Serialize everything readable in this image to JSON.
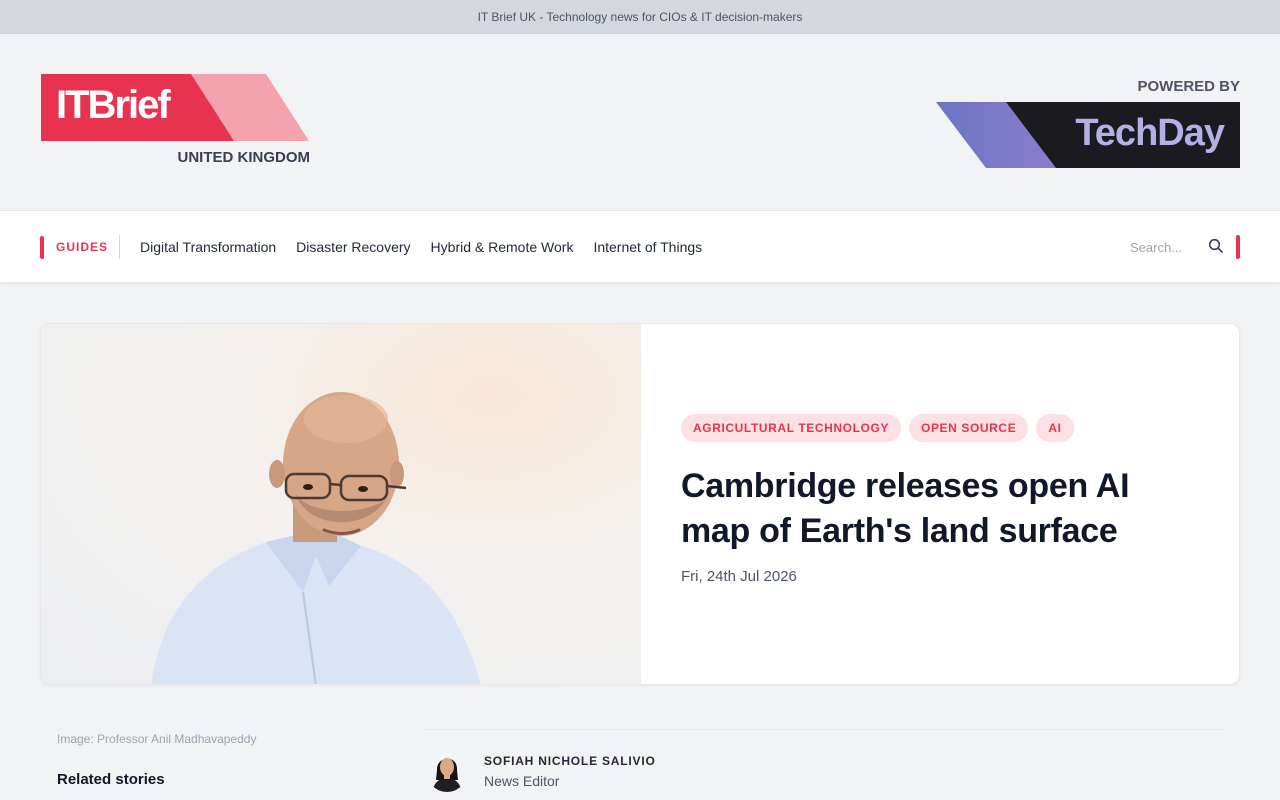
{
  "topbar": {
    "text": "IT Brief UK - Technology news for CIOs & IT decision-makers"
  },
  "masthead": {
    "logo_text": "ITBrief",
    "region": "UNITED KINGDOM",
    "powered_by": "POWERED BY",
    "partner_logo_text": "TechDay"
  },
  "nav": {
    "guides_label": "GUIDES",
    "links": [
      {
        "label": "Digital Transformation"
      },
      {
        "label": "Disaster Recovery"
      },
      {
        "label": "Hybrid & Remote Work"
      },
      {
        "label": "Internet of Things"
      }
    ],
    "search_placeholder": "Search..."
  },
  "article": {
    "tags": [
      {
        "label": "AGRICULTURAL TECHNOLOGY"
      },
      {
        "label": "OPEN SOURCE"
      },
      {
        "label": "AI"
      }
    ],
    "headline": "Cambridge releases open AI map of Earth's land surface",
    "date": "Fri, 24th Jul 2026",
    "image_caption": "Image: Professor Anil Madhavapeddy"
  },
  "sidebar": {
    "related_heading": "Related stories"
  },
  "author": {
    "name": "SOFIAH NICHOLE SALIVIO",
    "role": "News Editor"
  },
  "colors": {
    "accent": "#e83350",
    "accent_light": "#f4a2ae",
    "tag_bg": "#fde0e4",
    "partner_dark": "#1a1a1f",
    "partner_purple": "#8a86d0"
  }
}
